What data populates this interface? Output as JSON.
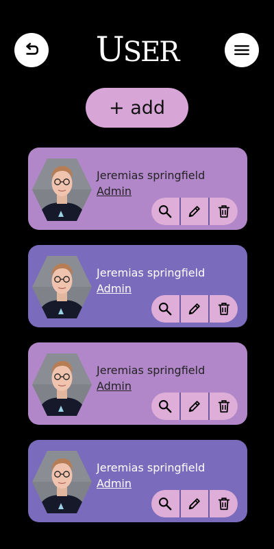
{
  "header": {
    "back_icon": "undo-arrow-icon",
    "menu_icon": "hamburger-menu-icon",
    "logo_first": "U",
    "logo_rest": "SER"
  },
  "add_button": {
    "label": "+ add"
  },
  "users": [
    {
      "name": "Jeremias springfield",
      "role": "Admin",
      "theme": "light"
    },
    {
      "name": "Jeremias springfield",
      "role": "Admin",
      "theme": "dark"
    },
    {
      "name": "Jeremias springfield",
      "role": "Admin",
      "theme": "light"
    },
    {
      "name": "Jeremias springfield",
      "role": "Admin",
      "theme": "dark"
    }
  ],
  "actions": {
    "view_icon": "search-icon",
    "edit_icon": "pencil-icon",
    "delete_icon": "trash-icon"
  },
  "colors": {
    "background": "#000000",
    "card_light": "#b287c9",
    "card_dark": "#7b6bbd",
    "button_pink": "#deaed9",
    "add_button": "#d7a6d7"
  }
}
